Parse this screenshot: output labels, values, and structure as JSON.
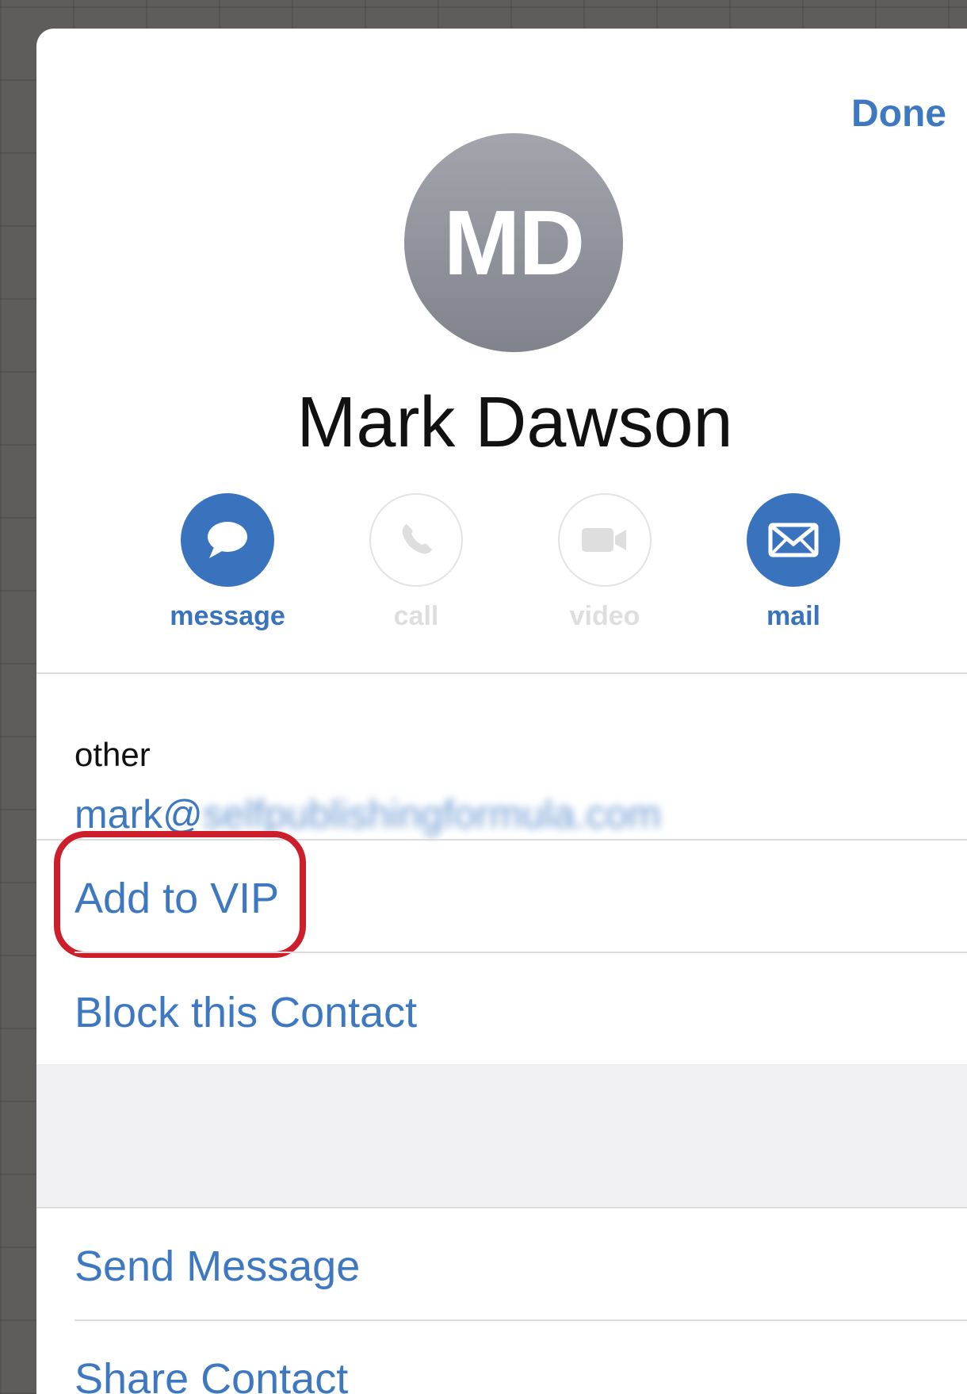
{
  "header": {
    "done_label": "Done"
  },
  "contact": {
    "initials": "MD",
    "name": "Mark Dawson"
  },
  "actions": [
    {
      "label": "message",
      "icon": "speech-bubble-icon",
      "enabled": true
    },
    {
      "label": "call",
      "icon": "phone-icon",
      "enabled": false
    },
    {
      "label": "video",
      "icon": "video-camera-icon",
      "enabled": false
    },
    {
      "label": "mail",
      "icon": "envelope-icon",
      "enabled": true
    }
  ],
  "email_field": {
    "label": "other",
    "value_visible": "mark@",
    "value_obscured": "selfpublishingformula.com"
  },
  "options": {
    "add_vip": "Add to VIP",
    "block": "Block this Contact",
    "send_message": "Send Message",
    "share_contact": "Share Contact"
  },
  "colors": {
    "accent": "#3d78c0",
    "highlight_ring": "#cc1f2b",
    "disabled": "#dedede"
  }
}
